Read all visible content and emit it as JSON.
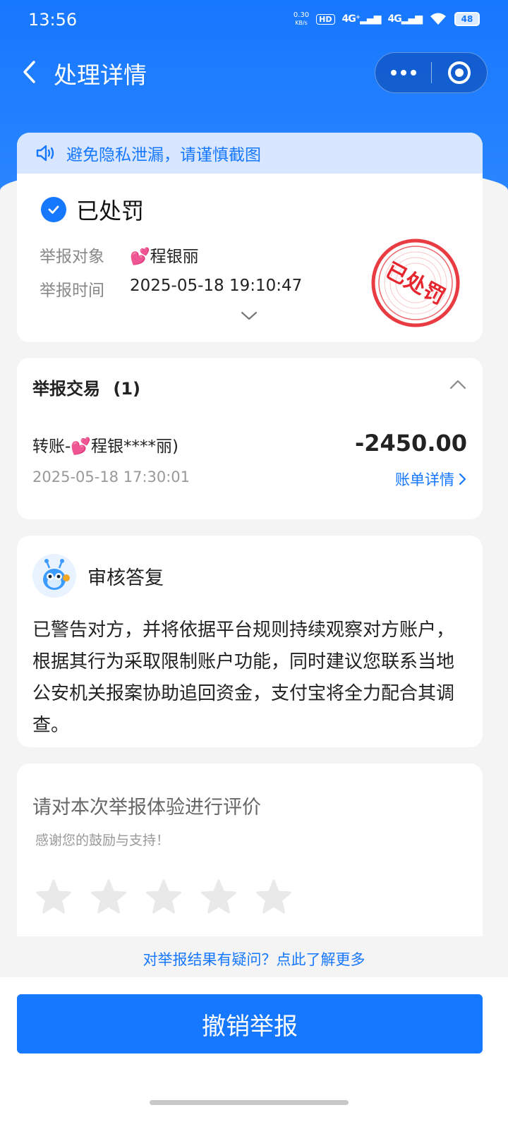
{
  "status_bar": {
    "time": "13:56",
    "net_speed_value": "0.30",
    "net_speed_unit": "KB/s",
    "hd_label": "HD",
    "signal1": "4G⁺",
    "signal2": "4G",
    "battery": "48"
  },
  "nav": {
    "title": "处理详情"
  },
  "result_card": {
    "notice": "避免隐私泄漏，请谨慎截图",
    "status_title": "已处罚",
    "target_label": "举报对象",
    "target_emoji": "💕",
    "target_value": "程银丽",
    "time_label": "举报时间",
    "time_value": "2025-05-18 19:10:47",
    "stamp_text": "已处罚",
    "colors": {
      "stamp": "#e5262e",
      "accent": "#1677ff"
    }
  },
  "trade_card": {
    "title": "举报交易",
    "count": "(1)",
    "name_prefix": "转账-",
    "name_emoji": "💕",
    "name_suffix": "程银****丽)",
    "amount": "-2450.00",
    "time": "2025-05-18 17:30:01",
    "detail_link": "账单详情"
  },
  "reply_card": {
    "title": "审核答复",
    "text": "已警告对方，并将依据平台规则持续观察对方账户，根据其行为采取限制账户功能，同时建议您联系当地公安机关报案协助追回资金，支付宝将全力配合其调查。"
  },
  "rating_card": {
    "title": "请对本次举报体验进行评价",
    "subtitle": "感谢您的鼓励与支持！",
    "stars_selected": 0,
    "stars_total": 5
  },
  "faq_link": "对举报结果有疑问？点此了解更多",
  "bottom": {
    "cancel_button": "撤销举报"
  }
}
